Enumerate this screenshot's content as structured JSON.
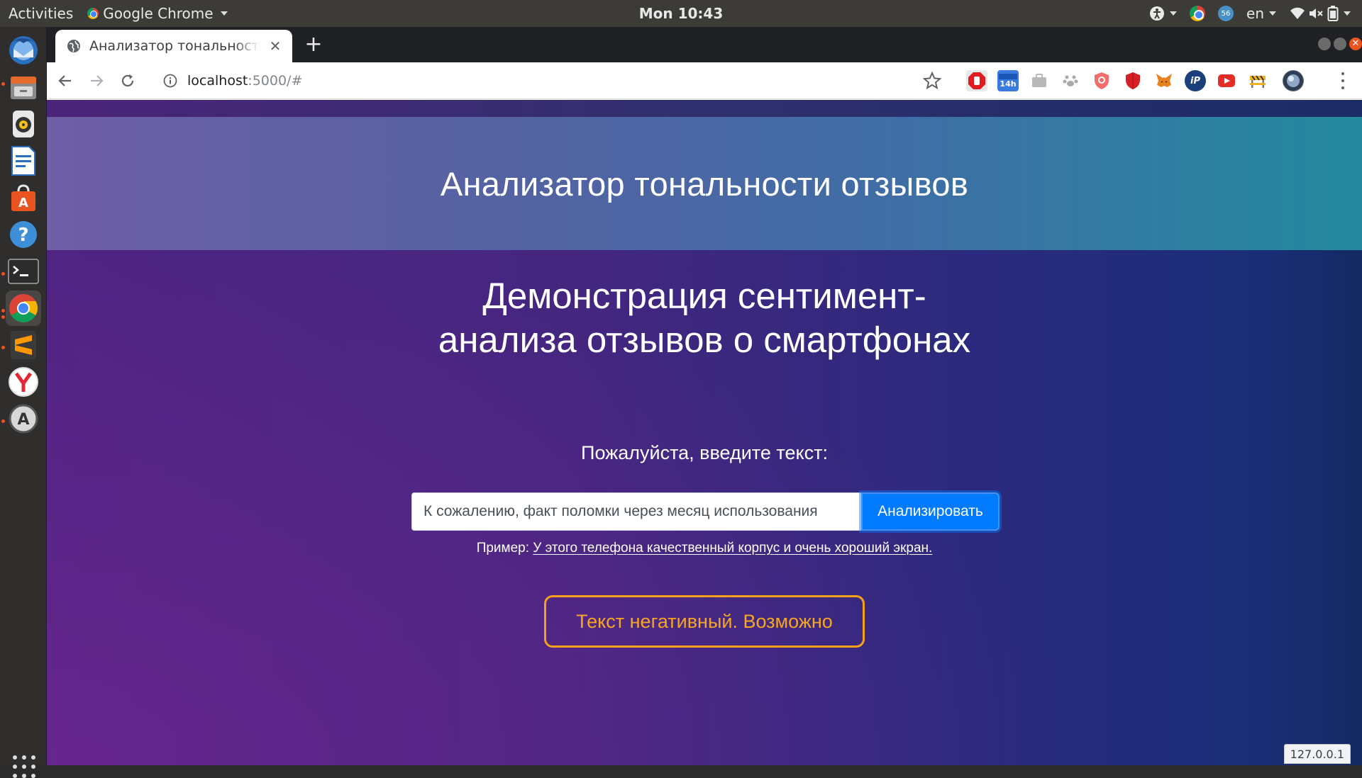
{
  "topbar": {
    "activities": "Activities",
    "app_name": "Google Chrome",
    "clock": "Mon 10:43",
    "tray_badge": "56",
    "lang": "en"
  },
  "dock": {
    "items": [
      "thunderbird-mail",
      "files",
      "rhythmbox",
      "libreoffice-writer",
      "ubuntu-software",
      "help",
      "terminal",
      "google-chrome",
      "sublime-text",
      "yandex-browser",
      "software-updater"
    ],
    "active_item": "google-chrome"
  },
  "browser": {
    "tab_title": "Анализатор тональности отзывов",
    "url_host": "localhost",
    "url_rest": ":5000/#",
    "ext_badge": "14h",
    "host_badge": "127.0.0.1"
  },
  "page": {
    "header_title": "Анализатор тональности отзывов",
    "subtitle_line1": "Демонстрация сентимент-",
    "subtitle_line2": "анализа отзывов о смартфонах",
    "prompt_label": "Пожалуйста, введите текст:",
    "input_value": "К сожалению, факт поломки через месяц использования",
    "analyze_label": "Анализировать",
    "example_prefix": "Пример:",
    "example_link": "У этого телефона качественный корпус и очень хороший экран.",
    "result_text": "Текст негативный. Возможно"
  },
  "colors": {
    "accent_button": "#007bff",
    "result_border": "#f5a21a",
    "header_start": "#6e5ea5",
    "header_end": "#238a9e"
  }
}
